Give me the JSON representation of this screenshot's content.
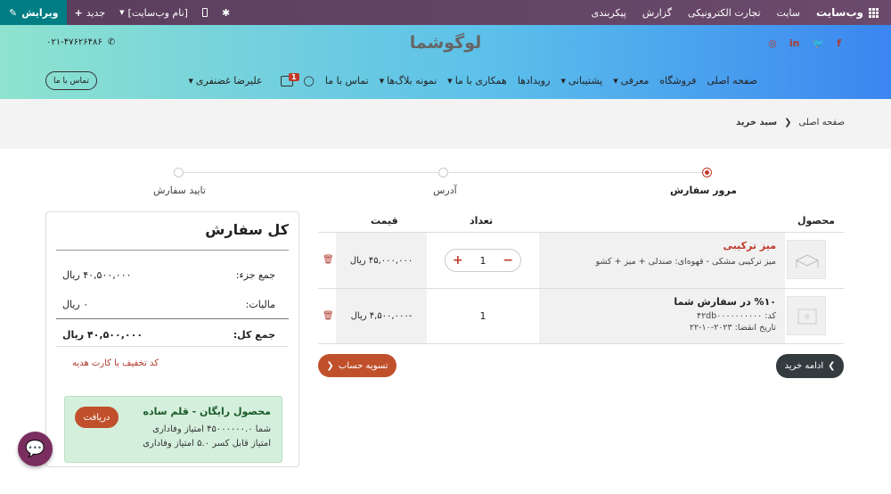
{
  "adminbar": {
    "edit_label": "ویرایش",
    "new_label": "جدید",
    "website_name": "[نام وب‌سایت]",
    "brand": "وب‌سایت",
    "menu": [
      "سایت",
      "تجارت الکترونیکی",
      "گزارش",
      "پیکربندی"
    ]
  },
  "header": {
    "phone": "۰۲۱-۴۷۶۲۶۴۸۶",
    "logo_text": "لوگوشما",
    "contact_button": "تماس با ما",
    "nav": [
      {
        "label": "صفحه اصلی",
        "dropdown": false
      },
      {
        "label": "فروشگاه",
        "dropdown": false
      },
      {
        "label": "معرفی",
        "dropdown": true
      },
      {
        "label": "پشتیبانی",
        "dropdown": true
      },
      {
        "label": "رویدادها",
        "dropdown": false
      },
      {
        "label": "همکاری با ما",
        "dropdown": true
      },
      {
        "label": "نمونه بلاگ‌ها",
        "dropdown": true
      },
      {
        "label": "تماس با ما",
        "dropdown": false
      }
    ],
    "cart_count": "1",
    "user_name": "علیرضا غضنفری",
    "social_icons": [
      "facebook-icon",
      "twitter-icon",
      "linkedin-icon",
      "instagram-icon"
    ]
  },
  "breadcrumb": {
    "home": "صفحه اصلی",
    "current": "سبد خرید"
  },
  "steps": [
    "مرور سفارش",
    "آدرس",
    "تایید سفارش"
  ],
  "table": {
    "headers": {
      "product": "محصول",
      "quantity": "تعداد",
      "price": "قیمت"
    },
    "rows": [
      {
        "name": "میز ترکیبی",
        "desc": "میز ترکیبی مشکی - قهوه‌ای: صندلی + میز + کشو",
        "quantity": "1",
        "price": "۴۵,۰۰۰,۰۰۰ ریال"
      },
      {
        "name": "%۱۰ در سفارش شما",
        "code": "کد: ۴۲db۰۰۰۰۰۰۰۰۰۰",
        "expiry": "تاریخ انقضا: ۲۰۲۳-۱۰-۲۲",
        "quantity": "1",
        "price": "-۴,۵۰۰,۰۰۰ ریال"
      }
    ]
  },
  "buttons": {
    "checkout": "تسویه حساب",
    "continue": "ادامه خرید"
  },
  "summary": {
    "title": "کل سفارش",
    "subtotal_label": "جمع جزء:",
    "subtotal_value": "۴۰,۵۰۰,۰۰۰ ریال",
    "tax_label": "مالیات:",
    "tax_value": "۰ ریال",
    "total_label": "جمع کل:",
    "total_value": "۴۰,۵۰۰,۰۰۰ ریال",
    "coupon_link": "کد تخفیف یا کارت هدیه",
    "reward": {
      "title": "محصول رایگان - قلم ساده",
      "line1": "شما ۴۵۰۰۰۰۰۰.۰ امتیاز وفاداری",
      "line2": "امتیاز قابل کسر ۵.۰ امتیاز وفاداری",
      "button": "دریافت"
    }
  },
  "colors": {
    "accent": "#c0392b",
    "admin_bar": "#5a3d5c",
    "edit_bg": "#017e84"
  }
}
